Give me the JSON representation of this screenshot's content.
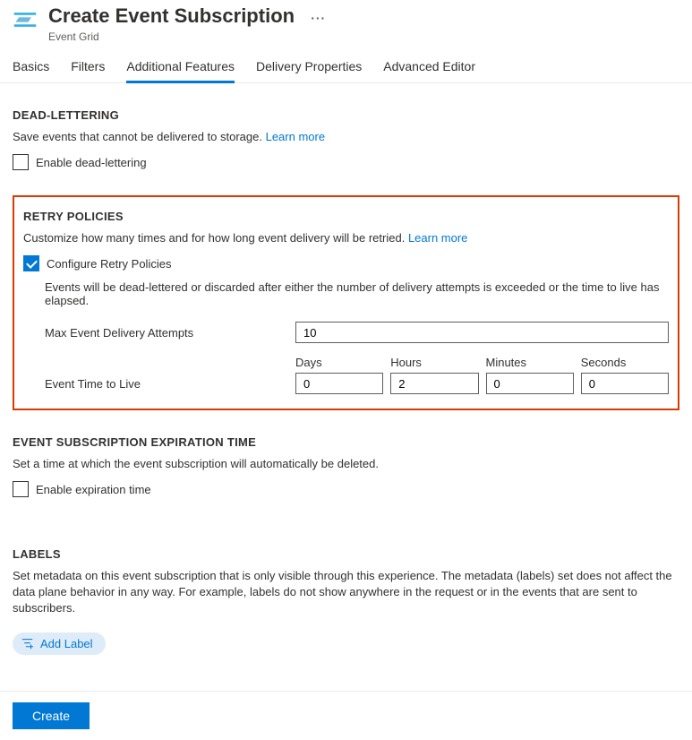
{
  "header": {
    "title": "Create Event Subscription",
    "subtitle": "Event Grid"
  },
  "tabs": [
    {
      "label": "Basics",
      "active": false
    },
    {
      "label": "Filters",
      "active": false
    },
    {
      "label": "Additional Features",
      "active": true
    },
    {
      "label": "Delivery Properties",
      "active": false
    },
    {
      "label": "Advanced Editor",
      "active": false
    }
  ],
  "dead_lettering": {
    "title": "DEAD-LETTERING",
    "desc": "Save events that cannot be delivered to storage.",
    "learn_more": "Learn more",
    "checkbox_label": "Enable dead-lettering",
    "checked": false
  },
  "retry": {
    "title": "RETRY POLICIES",
    "desc": "Customize how many times and for how long event delivery will be retried.",
    "learn_more": "Learn more",
    "checkbox_label": "Configure Retry Policies",
    "checked": true,
    "note": "Events will be dead-lettered or discarded after either the number of delivery attempts is exceeded or the time to live has elapsed.",
    "max_attempts_label": "Max Event Delivery Attempts",
    "max_attempts_value": "10",
    "ttl_label": "Event Time to Live",
    "ttl": {
      "days_label": "Days",
      "days": "0",
      "hours_label": "Hours",
      "hours": "2",
      "minutes_label": "Minutes",
      "minutes": "0",
      "seconds_label": "Seconds",
      "seconds": "0"
    }
  },
  "expiration": {
    "title": "EVENT SUBSCRIPTION EXPIRATION TIME",
    "desc": "Set a time at which the event subscription will automatically be deleted.",
    "checkbox_label": "Enable expiration time",
    "checked": false
  },
  "labels": {
    "title": "LABELS",
    "desc": "Set metadata on this event subscription that is only visible through this experience. The metadata (labels) set does not affect the data plane behavior in any way. For example, labels do not show anywhere in the request or in the events that are sent to subscribers.",
    "add_label": "Add Label"
  },
  "footer": {
    "create": "Create"
  }
}
